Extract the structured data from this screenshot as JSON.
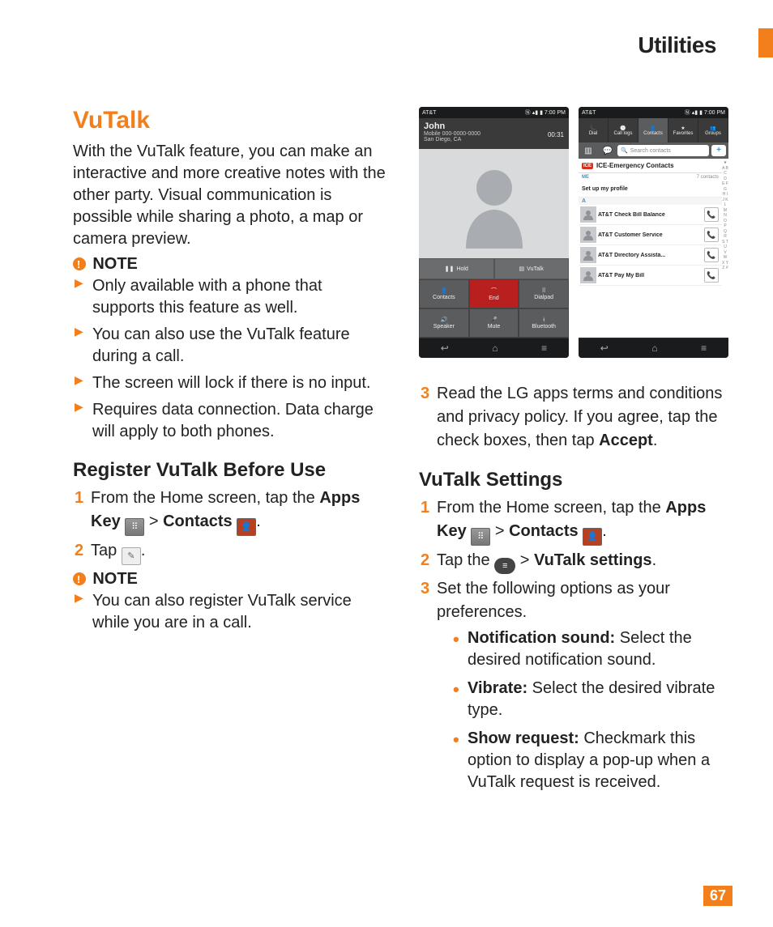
{
  "header": {
    "title": "Utilities"
  },
  "page_number": "67",
  "left": {
    "h1": "VuTalk",
    "intro": "With the VuTalk feature, you can make an interactive and more creative notes with the other party. Visual communication is possible while sharing a photo, a map or camera preview.",
    "note1_label": "NOTE",
    "note1_items": [
      "Only available with a phone that supports this feature as well.",
      "You can also use the VuTalk feature during a call.",
      "The screen will lock if there is no input.",
      "Requires data connection. Data charge will apply to both phones."
    ],
    "h2a": "Register VuTalk Before Use",
    "step1a_pre": "From the Home screen, tap the ",
    "step1a_bold": "Apps Key",
    "step1a_gt": " > ",
    "step1a_contacts": "Contacts",
    "step1a_period": ".",
    "step2a": "Tap ",
    "step2a_period": ".",
    "note2_label": "NOTE",
    "note2_items": [
      "You can also register VuTalk service while you are in a call."
    ]
  },
  "right": {
    "step3_text": "Read the LG apps terms and conditions and privacy policy. If you agree, tap the check boxes, then tap ",
    "step3_bold": "Accept",
    "step3_period": ".",
    "h2b": "VuTalk Settings",
    "step1b_pre": "From the Home screen, tap the ",
    "step1b_bold": "Apps Key",
    "step1b_gt": " > ",
    "step1b_contacts": "Contacts",
    "step1b_period": ".",
    "step2b_pre": "Tap the ",
    "step2b_bold1": "Menu Key",
    "step2b_gt": " > ",
    "step2b_bold2": "VuTalk settings",
    "step2b_period": ".",
    "step3b": "Set the following options as your preferences.",
    "bullets": [
      {
        "bold": "Notification sound:",
        "text": " Select the desired notification sound."
      },
      {
        "bold": "Vibrate:",
        "text": " Select the desired vibrate type."
      },
      {
        "bold": "Show request:",
        "text": " Checkmark this option to display a pop-up when a VuTalk request is received."
      }
    ]
  },
  "phone1": {
    "carrier": "AT&T",
    "time": "7:00 PM",
    "name": "John",
    "number": "Mobile 000-0000-0000",
    "location": "San Diego, CA",
    "timer": "00:31",
    "hold": "Hold",
    "vutalk": "VuTalk",
    "buttons": [
      "Contacts",
      "End",
      "Dialpad",
      "Speaker",
      "Mute",
      "Bluetooth"
    ]
  },
  "phone2": {
    "carrier": "AT&T",
    "time": "7:00 PM",
    "tabs": [
      "Dial",
      "Call logs",
      "Contacts",
      "Favorites",
      "Groups"
    ],
    "active_tab_index": 2,
    "search_placeholder": "Search contacts",
    "ice": "ICE-Emergency Contacts",
    "me_label": "ME",
    "me_count": "7 contacts",
    "setup": "Set up my profile",
    "letter": "A",
    "contacts": [
      "AT&T Check Bill Balance",
      "AT&T Customer Service",
      "AT&T Directory Assista...",
      "AT&T Pay My Bill"
    ],
    "alpha": "★ A B C D E F G H I J K L M N O P Q R S T U V W X Y Z #"
  }
}
